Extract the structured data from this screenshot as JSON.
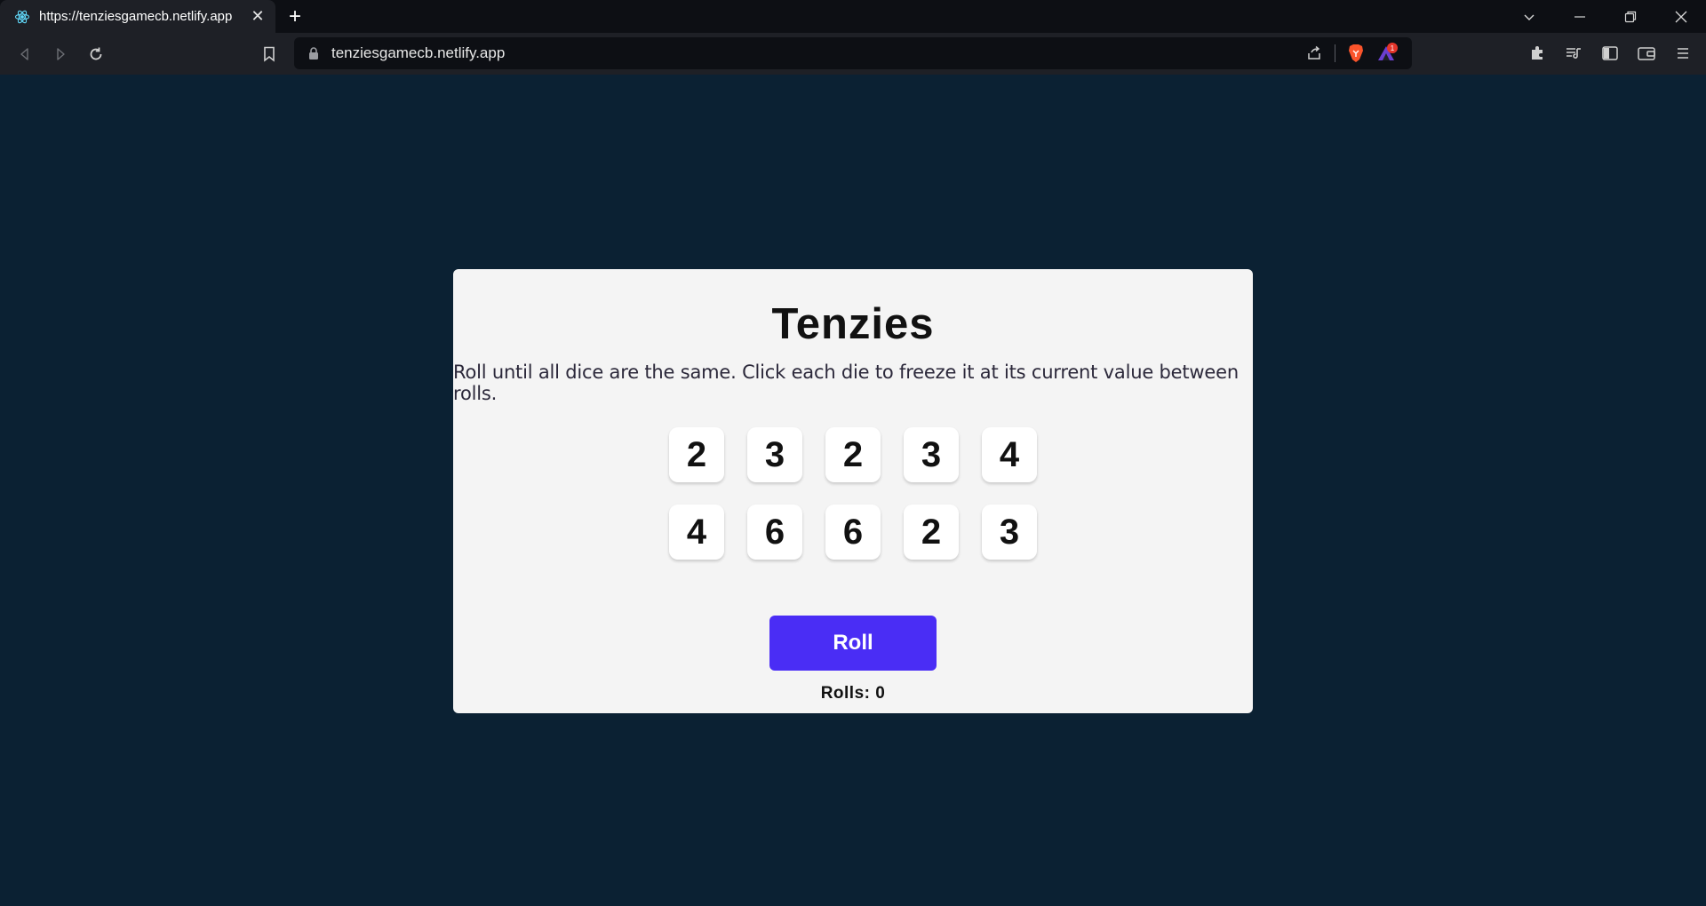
{
  "browser": {
    "tab": {
      "title": "https://tenziesgamecb.netlify.app",
      "favicon": "react-icon"
    },
    "url": "tenziesgamecb.netlify.app",
    "accent": "#0d0f14"
  },
  "game": {
    "title": "Tenzies",
    "instructions": "Roll until all dice are the same. Click each die to freeze it at its current value between rolls.",
    "dice": [
      "2",
      "3",
      "2",
      "3",
      "4",
      "4",
      "6",
      "6",
      "2",
      "3"
    ],
    "roll_label": "Roll",
    "rolls_label": "Rolls: 0",
    "colors": {
      "background": "#0b2133",
      "card": "#f4f4f4",
      "button": "#4a2df5"
    }
  }
}
